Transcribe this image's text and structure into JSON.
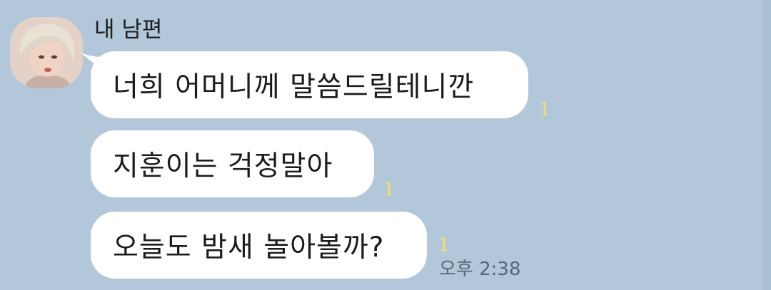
{
  "chat": {
    "sender_name": "내 남편",
    "messages": [
      {
        "text": "너희 어머니께 말씀드릴테니깐",
        "unread": "1"
      },
      {
        "text": "지훈이는 걱정말아",
        "unread": "1"
      },
      {
        "text": "오늘도 밤새 놀아볼까?",
        "unread": "1"
      }
    ],
    "timestamp": "오후 2:38"
  },
  "colors": {
    "background": "#b2c7da",
    "bubble": "#ffffff",
    "unread_count": "#f7e35c",
    "timestamp": "#556777"
  },
  "icons": {
    "avatar": "profile-photo"
  }
}
